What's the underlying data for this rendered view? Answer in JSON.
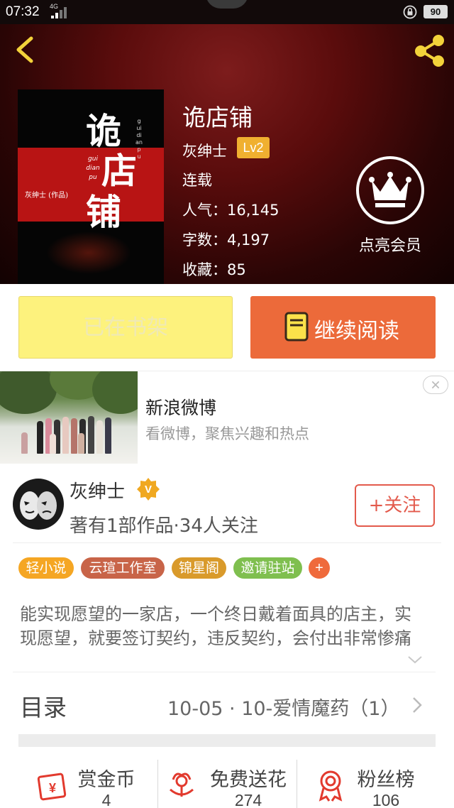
{
  "status_bar": {
    "time": "07:32",
    "network": "4G",
    "battery": "90"
  },
  "cover": {
    "title_chars": [
      "诡",
      "店",
      "铺"
    ],
    "pinyin": [
      "gui",
      "dian",
      "pu"
    ],
    "side_text": "guidianpu",
    "author_text": "灰绅士 (作品)"
  },
  "book": {
    "title": "诡店铺",
    "author": "灰绅士",
    "level": "Lv2",
    "status": "连载",
    "popularity": "人气：16,145",
    "word_count": "字数：4,197",
    "favorites": "收藏：85"
  },
  "vip": {
    "label": "点亮会员",
    "icon": "crown-icon"
  },
  "actions": {
    "shelf_label": "已在书架",
    "read_label": "继续阅读"
  },
  "ad": {
    "title": "新浪微博",
    "description": "看微博，聚焦兴趣和热点"
  },
  "author_card": {
    "name": "灰绅士",
    "meta": "著有1部作品·34人关注",
    "follow_label": "+关注",
    "tags": [
      {
        "label": "轻小说",
        "color": "#f5a623"
      },
      {
        "label": "云瑄工作室",
        "color": "#c86448"
      },
      {
        "label": "锦星阁",
        "color": "#d99a2b"
      },
      {
        "label": "邀请驻站",
        "color": "#7fbf4f"
      }
    ],
    "add_tag_label": "+",
    "description": "能实现愿望的一家店，一个终日戴着面具的店主，实现愿望，就要签订契约，违反契约，会付出非常惨痛的代价……"
  },
  "catalog": {
    "label": "目录",
    "latest": "10-05 · 10-爱情魔药（1）"
  },
  "stats": [
    {
      "name": "赏金币",
      "value": "4",
      "icon": "coin-icon"
    },
    {
      "name": "免费送花",
      "value": "274",
      "icon": "flower-icon"
    },
    {
      "name": "粉丝榜",
      "value": "106",
      "icon": "rank-medal-icon"
    }
  ],
  "colors": {
    "accent_orange": "#ec6a3a",
    "shelf_yellow": "#fdf27d",
    "follow_red": "#e35a4c",
    "hero_red": "#5a0c0c"
  }
}
